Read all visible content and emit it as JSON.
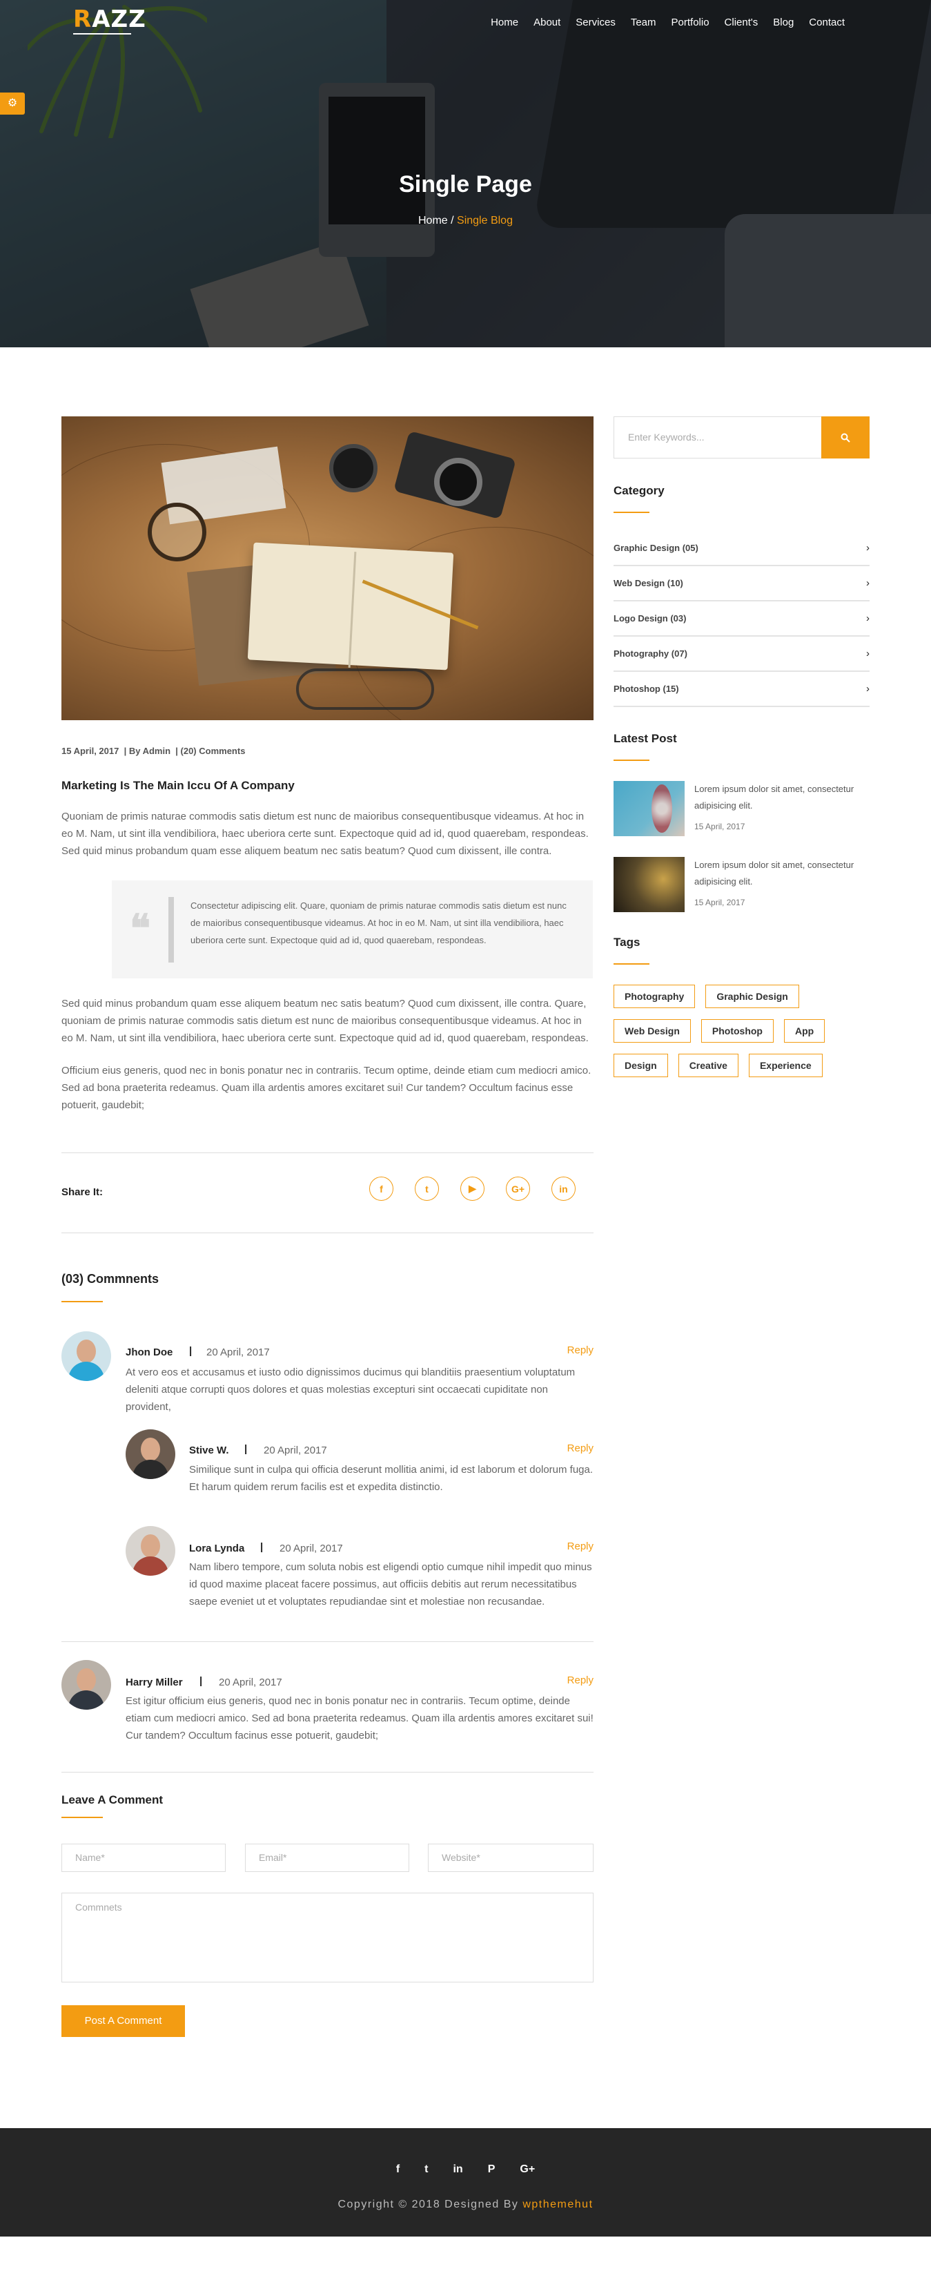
{
  "header": {
    "logo_first": "R",
    "logo_rest": "AZZ",
    "nav": [
      "Home",
      "About",
      "Services",
      "Team",
      "Portfolio",
      "Client's",
      "Blog",
      "Contact"
    ],
    "settings_icon": "gear-icon"
  },
  "hero": {
    "title": "Single Page",
    "crumb_home": "Home /",
    "crumb_active": "Single Blog"
  },
  "post": {
    "date": "15 April, 2017",
    "author": "| By Admin",
    "comments_count": "| (20) Comments",
    "title": "Marketing Is The Main Iccu Of A Company",
    "para1": "Quoniam de primis naturae commodis satis dietum est nunc de maioribus consequentibusque videamus. At hoc in eo M. Nam, ut sint illa vendibiliora, haec uberiora certe sunt. Expectoque quid ad id, quod quaerebam, respondeas. Sed quid minus probandum quam esse aliquem beatum nec satis beatum? Quod cum dixissent, ille contra.",
    "quote": "Consectetur adipiscing elit. Quare, quoniam de primis naturae commodis satis dietum est nunc de maioribus consequentibusque videamus. At hoc in eo M. Nam, ut sint illa vendibiliora, haec uberiora certe sunt. Expectoque quid ad id, quod quaerebam, respondeas.",
    "para2": "Sed quid minus probandum quam esse aliquem beatum nec satis beatum? Quod cum dixissent, ille contra. Quare, quoniam de primis naturae commodis satis dietum est nunc de maioribus consequentibusque videamus. At hoc in eo M. Nam, ut sint illa vendibiliora, haec uberiora certe sunt. Expectoque quid ad id, quod quaerebam, respondeas.",
    "para3": "Officium eius generis, quod nec in bonis ponatur nec in contrariis. Tecum optime, deinde etiam cum mediocri amico. Sed ad bona praeterita redeamus. Quam illa ardentis amores excitaret sui! Cur tandem? Occultum facinus esse potuerit, gaudebit;"
  },
  "share": {
    "label": "Share It:",
    "icons": [
      "f",
      "t",
      "▶",
      "G+",
      "in"
    ]
  },
  "comments": {
    "title": "(03) Commnents",
    "reply_label": "Reply",
    "items": [
      {
        "name": "Jhon Doe",
        "date": "20 April, 2017",
        "text": "At vero eos et accusamus et iusto odio dignissimos ducimus qui blanditiis praesentium voluptatum deleniti atque corrupti quos dolores et quas molestias excepturi sint occaecati cupiditate non provident,"
      },
      {
        "name": "Stive W.",
        "date": "20 April, 2017",
        "text": "Similique sunt in culpa qui officia deserunt mollitia animi, id est laborum et dolorum fuga. Et harum quidem rerum facilis est et expedita distinctio."
      },
      {
        "name": "Lora Lynda",
        "date": "20 April, 2017",
        "text": "Nam libero tempore, cum soluta nobis est eligendi optio cumque nihil impedit quo minus id quod maxime placeat facere possimus, aut officiis debitis aut rerum necessitatibus saepe eveniet ut et voluptates repudiandae sint et molestiae non recusandae."
      },
      {
        "name": "Harry Miller",
        "date": "20 April, 2017",
        "text": "Est igitur officium eius generis, quod nec in bonis ponatur nec in contrariis. Tecum optime, deinde etiam cum mediocri amico. Sed ad bona praeterita redeamus. Quam illa ardentis amores excitaret sui! Cur tandem? Occultum facinus esse potuerit, gaudebit;"
      }
    ]
  },
  "form": {
    "title": "Leave A Comment",
    "name_placeholder": "Name*",
    "email_placeholder": "Email*",
    "website_placeholder": "Website*",
    "comment_placeholder": "Commnets",
    "submit_label": "Post A Comment"
  },
  "sidebar": {
    "search_placeholder": "Enter Keywords...",
    "category_title": "Category",
    "categories": [
      "Graphic Design (05)",
      "Web Design (10)",
      "Logo Design (03)",
      "Photography (07)",
      "Photoshop (15)"
    ],
    "latest_title": "Latest Post",
    "latest": [
      {
        "text": "Lorem ipsum dolor sit amet, consectetur adipisicing elit.",
        "date": "15 April, 2017"
      },
      {
        "text": "Lorem ipsum dolor sit amet, consectetur adipisicing elit.",
        "date": "15 April, 2017"
      }
    ],
    "tags_title": "Tags",
    "tags": [
      "Photography",
      "Graphic Design",
      "Web Design",
      "Photoshop",
      "App",
      "Design",
      "Creative",
      "Experience"
    ]
  },
  "footer": {
    "icons": [
      "f",
      "t",
      "in",
      "P",
      "G+"
    ],
    "copy": "Copyright © 2018 Designed By",
    "brand": "wpthemehut"
  },
  "colors": {
    "accent": "#f39c12",
    "footer_bg": "#262626"
  }
}
